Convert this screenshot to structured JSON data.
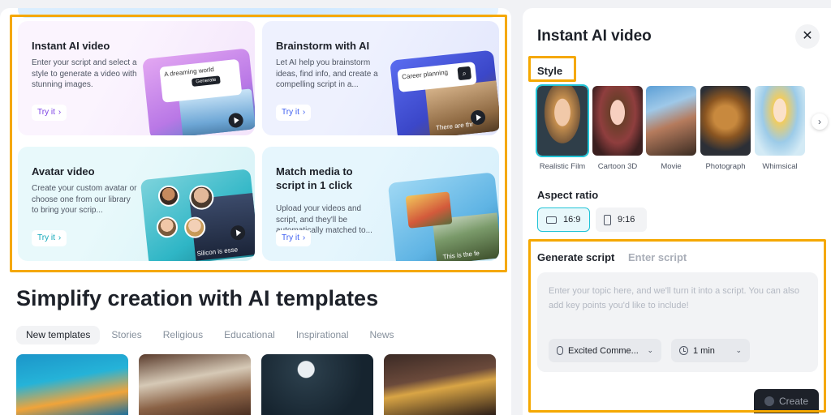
{
  "cards": [
    {
      "title": "Instant AI video",
      "desc": "Enter your script and select a style to generate a video with stunning images.",
      "cta": "Try it",
      "thumb_prompt": "A dreaming world",
      "thumb_button": "Generate"
    },
    {
      "title": "Brainstorm with AI",
      "desc": "Let AI help you brainstorm ideas, find info, and create a compelling script in a...",
      "cta": "Try it",
      "thumb_prompt": "Career planning",
      "thumb_caption": "There are thr"
    },
    {
      "title": "Avatar video",
      "desc": "Create your custom avatar or choose one from our library to bring your scrip...",
      "cta": "Try it",
      "thumb_caption": "Silicon is esse"
    },
    {
      "title": "Match media to script in 1 click",
      "desc": "Upload your videos and script, and they'll be automatically matched to...",
      "cta": "Try it",
      "thumb_caption": "This is the fe"
    }
  ],
  "templates": {
    "heading": "Simplify creation with AI templates",
    "tabs": [
      "New templates",
      "Stories",
      "Religious",
      "Educational",
      "Inspirational",
      "News"
    ]
  },
  "panel": {
    "title": "Instant AI video",
    "close": "✕",
    "style_label": "Style",
    "styles": [
      "Realistic Film",
      "Cartoon 3D",
      "Movie",
      "Photograph",
      "Whimsical"
    ],
    "scroll_next": "›",
    "aspect_label": "Aspect ratio",
    "ratios": [
      "16:9",
      "9:16"
    ],
    "script_tabs": [
      "Generate script",
      "Enter script"
    ],
    "placeholder": "Enter your topic here, and we'll turn it into a script. You can also add key points you'd like to include!",
    "voice": "Excited Comme...",
    "duration": "1 min",
    "create": "Create"
  },
  "accent": "#20c3d6",
  "highlight": "#f5a800"
}
